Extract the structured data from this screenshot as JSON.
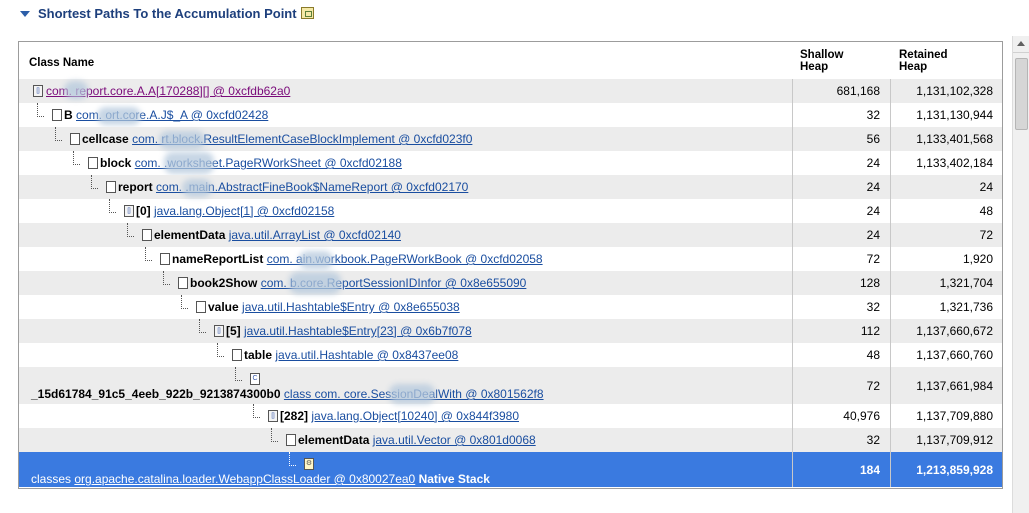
{
  "section": {
    "title": "Shortest Paths To the Accumulation Point"
  },
  "columns": {
    "class_name": "Class Name",
    "shallow_heap": "Shallow Heap",
    "retained_heap": "Retained Heap"
  },
  "rows": [
    {
      "field": "",
      "ref": "com.   report.core.A.A[170288][] @ 0xcfdb62a0",
      "suffix": "",
      "shallow": "681,168",
      "retained": "1,131,102,328"
    },
    {
      "field": "B",
      "ref": "com.     ort.core.A.J$_A @ 0xcfd02428",
      "suffix": "",
      "shallow": "32",
      "retained": "1,131,130,944"
    },
    {
      "field": "cellcase",
      "ref": "com.       rt.block.ResultElementCaseBlockImplement @ 0xcfd023f0",
      "suffix": "",
      "shallow": "56",
      "retained": "1,133,401,568"
    },
    {
      "field": "block",
      "ref": "com.        .worksheet.PageRWorkSheet @ 0xcfd02188",
      "suffix": "",
      "shallow": "24",
      "retained": "1,133,402,184"
    },
    {
      "field": "report",
      "ref": "com.   .main.AbstractFineBook$NameReport @ 0xcfd02170",
      "suffix": "",
      "shallow": "24",
      "retained": "24"
    },
    {
      "field": "[0]",
      "ref": "java.lang.Object[1] @ 0xcfd02158",
      "suffix": "",
      "shallow": "24",
      "retained": "48"
    },
    {
      "field": "elementData",
      "ref": "java.util.ArrayList @ 0xcfd02140",
      "suffix": "",
      "shallow": "24",
      "retained": "72"
    },
    {
      "field": "nameReportList",
      "ref": "com.     ain.workbook.PageRWorkBook @ 0xcfd02058",
      "suffix": "",
      "shallow": "72",
      "retained": "1,920"
    },
    {
      "field": "book2Show",
      "ref": "com.      b.core.ReportSessionIDInfor @ 0x8e655090",
      "suffix": "",
      "shallow": "128",
      "retained": "1,321,704"
    },
    {
      "field": "value",
      "ref": "java.util.Hashtable$Entry @ 0x8e655038",
      "suffix": "",
      "shallow": "32",
      "retained": "1,321,736"
    },
    {
      "field": "[5]",
      "ref": "java.util.Hashtable$Entry[23] @ 0x6b7f078",
      "suffix": "",
      "shallow": "112",
      "retained": "1,137,660,672"
    },
    {
      "field": "table",
      "ref": "java.util.Hashtable @ 0x8437ee08",
      "suffix": "",
      "shallow": "48",
      "retained": "1,137,660,760"
    },
    {
      "field": "_15d61784_91c5_4eeb_922b_9213874300b0",
      "ref": "class com.      core.SessionDealWith @ 0x801562f8",
      "suffix": "",
      "shallow": "72",
      "retained": "1,137,661,984"
    },
    {
      "field": "[282]",
      "ref": "java.lang.Object[10240] @ 0x844f3980",
      "suffix": "",
      "shallow": "40,976",
      "retained": "1,137,709,880"
    },
    {
      "field": "elementData",
      "ref": "java.util.Vector @ 0x801d0068",
      "suffix": "",
      "shallow": "32",
      "retained": "1,137,709,912"
    },
    {
      "field": "classes",
      "ref": "org.apache.catalina.loader.WebappClassLoader @ 0x80027ea0",
      "suffix": "Native Stack",
      "shallow": "184",
      "retained": "1,213,859,928"
    }
  ],
  "icons": {
    "section_toggle": "collapse-triangle-icon",
    "header_action": "export-icon"
  },
  "colors": {
    "selection": "#3a7ae0",
    "link": "#1a4ea0",
    "visited_link": "#7a0a7a",
    "alt_row": "#ececec"
  }
}
